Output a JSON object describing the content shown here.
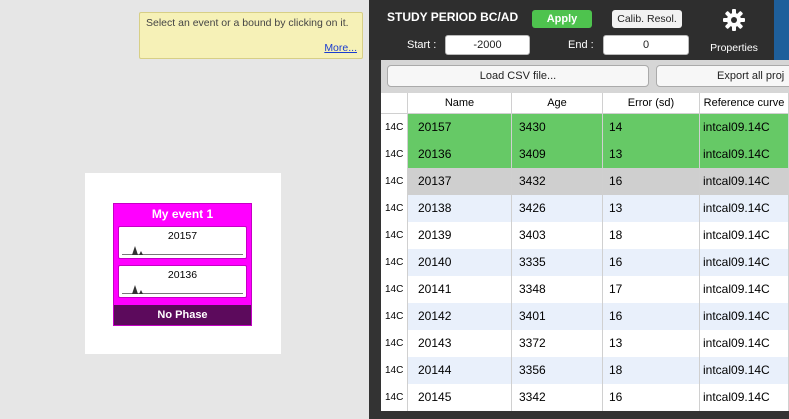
{
  "help": {
    "text": "Select an event or a bound by clicking on it.",
    "more_link": "More..."
  },
  "event": {
    "name": "My event 1",
    "dates": [
      "20157",
      "20136"
    ],
    "phase": "No Phase",
    "color": "#ff00ff"
  },
  "study_period": {
    "title": "STUDY PERIOD BC/AD",
    "apply_label": "Apply",
    "calib_label": "Calib. Resol.",
    "start_label": "Start :",
    "start_value": "-2000",
    "end_label": "End :",
    "end_value": "0",
    "properties_label": "Properties"
  },
  "csv": {
    "load_label": "Load CSV file...",
    "export_label": "Export all proj"
  },
  "table": {
    "columns": [
      "",
      "Name",
      "Age",
      "Error (sd)",
      "Reference curve"
    ],
    "rows": [
      {
        "method": "14C",
        "name": "20157",
        "age": "3430",
        "error": "14",
        "curve": "intcal09.14C",
        "state": "selected"
      },
      {
        "method": "14C",
        "name": "20136",
        "age": "3409",
        "error": "13",
        "curve": "intcal09.14C",
        "state": "selected"
      },
      {
        "method": "14C",
        "name": "20137",
        "age": "3432",
        "error": "16",
        "curve": "intcal09.14C",
        "state": "grey"
      },
      {
        "method": "14C",
        "name": "20138",
        "age": "3426",
        "error": "13",
        "curve": "intcal09.14C",
        "state": "alt"
      },
      {
        "method": "14C",
        "name": "20139",
        "age": "3403",
        "error": "18",
        "curve": "intcal09.14C",
        "state": "normal"
      },
      {
        "method": "14C",
        "name": "20140",
        "age": "3335",
        "error": "16",
        "curve": "intcal09.14C",
        "state": "alt"
      },
      {
        "method": "14C",
        "name": "20141",
        "age": "3348",
        "error": "17",
        "curve": "intcal09.14C",
        "state": "normal"
      },
      {
        "method": "14C",
        "name": "20142",
        "age": "3401",
        "error": "16",
        "curve": "intcal09.14C",
        "state": "alt"
      },
      {
        "method": "14C",
        "name": "20143",
        "age": "3372",
        "error": "13",
        "curve": "intcal09.14C",
        "state": "normal"
      },
      {
        "method": "14C",
        "name": "20144",
        "age": "3356",
        "error": "18",
        "curve": "intcal09.14C",
        "state": "alt"
      },
      {
        "method": "14C",
        "name": "20145",
        "age": "3342",
        "error": "16",
        "curve": "intcal09.14C",
        "state": "normal"
      }
    ]
  },
  "colors": {
    "selected": "#66c966",
    "grey": "#cfcfcf",
    "alt": "#e9f0fb",
    "normal": "#ffffff",
    "apply": "#4ec34e",
    "phase": "#5c0a5c"
  }
}
